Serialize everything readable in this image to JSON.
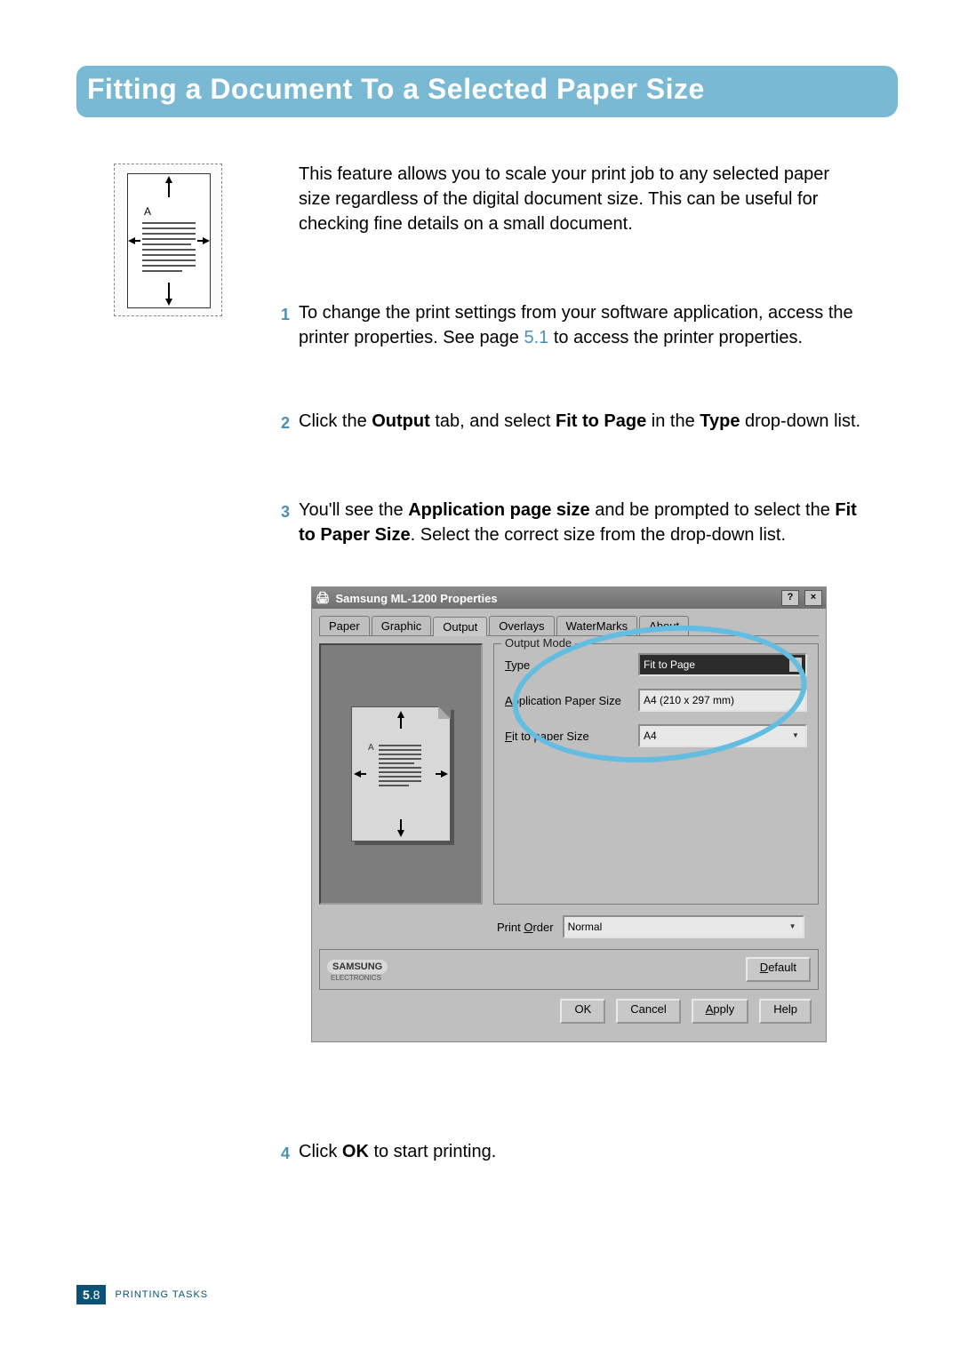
{
  "title": "Fitting a Document To a Selected Paper Size",
  "intro": "This feature allows you to scale your print job to any selected paper size regardless of the digital document size. This can be useful for checking fine details on a small document.",
  "illustration_label": "A",
  "steps": {
    "s1": {
      "num": "1",
      "text_a": "To change the print settings from your software application, access the printer properties. See page ",
      "link": "5.1",
      "text_b": " to access the printer properties."
    },
    "s2": {
      "num": "2",
      "text_a": "Click the ",
      "bold1": "Output",
      "text_b": " tab, and select ",
      "bold2": "Fit to Page",
      "text_c": " in the ",
      "bold3": "Type",
      "text_d": " drop-down list."
    },
    "s3": {
      "num": "3",
      "text_a": "You'll see the ",
      "bold1": "Application page size",
      "text_b": " and be prompted to select the ",
      "bold2": "Fit to Paper Size",
      "text_c": ". Select the correct size from the drop-down list."
    },
    "s4": {
      "num": "4",
      "text_a": "Click ",
      "bold1": "OK",
      "text_b": " to start printing."
    }
  },
  "dialog": {
    "title": "Samsung ML-1200 Properties",
    "help_btn": "?",
    "close_btn": "×",
    "tabs": [
      "Paper",
      "Graphic",
      "Output",
      "Overlays",
      "WaterMarks",
      "About"
    ],
    "active_tab_index": 2,
    "group_label": "Output Mode",
    "type_label": "Type",
    "type_value": "Fit to Page",
    "app_size_label": "Application Paper Size",
    "app_size_value": "A4 (210 x 297 mm)",
    "fit_size_label": "Fit to paper Size",
    "fit_size_value": "A4",
    "print_order_label": "Print Order",
    "print_order_value": "Normal",
    "logo": "SAMSUNG",
    "logo_sub": "ELECTRONICS",
    "default_btn": "Default",
    "ok_btn": "OK",
    "cancel_btn": "Cancel",
    "apply_btn": "Apply",
    "help_btn2": "Help",
    "preview_label": "A"
  },
  "footer": {
    "major": "5",
    "minor": ".8",
    "label": "PRINTING TASKS"
  }
}
